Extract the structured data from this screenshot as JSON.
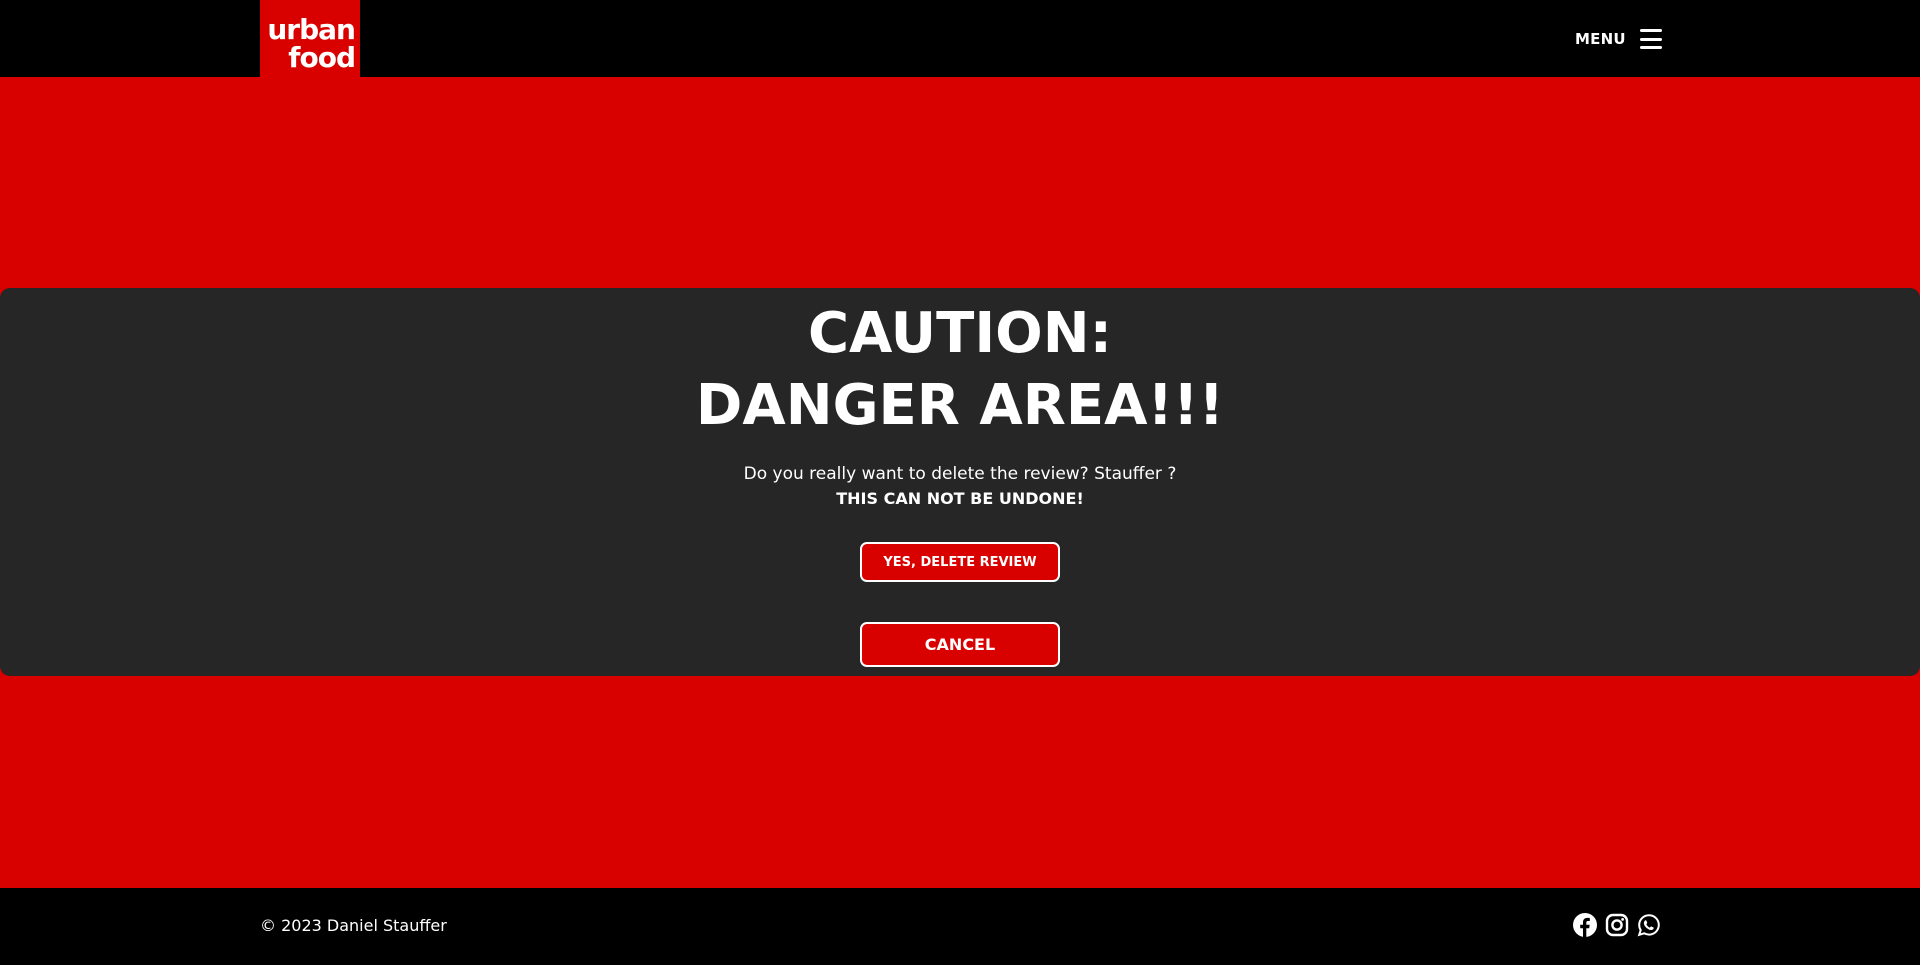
{
  "header": {
    "logo_line1": "urban",
    "logo_line2": "food",
    "menu_label": "MENU"
  },
  "dialog": {
    "title_line1": "CAUTION:",
    "title_line2": "DANGER AREA!!!",
    "question": "Do you really want to delete the review? Stauffer ?",
    "warning": "THIS CAN NOT BE UNDONE!",
    "confirm_label": "YES, DELETE REVIEW",
    "cancel_label": "CANCEL"
  },
  "footer": {
    "copyright": "© 2023 Daniel Stauffer",
    "social_icons": [
      "facebook-icon",
      "instagram-icon",
      "whatsapp-icon"
    ]
  },
  "colors": {
    "brand_red": "#d90000",
    "panel_dark": "#262626",
    "bar_black": "#000000",
    "text_white": "#ffffff"
  }
}
